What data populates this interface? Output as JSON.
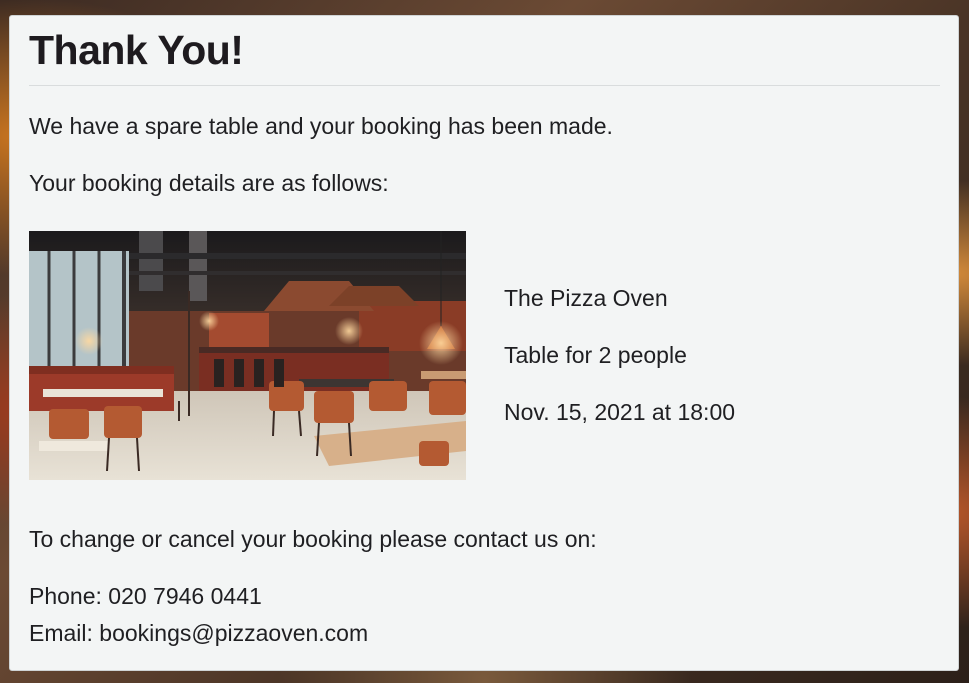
{
  "confirmation": {
    "title": "Thank You!",
    "intro": "We have a spare table and your booking has been made.",
    "details_heading": "Your booking details are as follows:",
    "image_alt": "Restaurant interior",
    "booking": {
      "restaurant": "The Pizza Oven",
      "party": "Table for 2 people",
      "datetime": "Nov. 15, 2021 at 18:00"
    },
    "contact_heading": "To change or cancel your booking please contact us on:",
    "phone": "Phone: 020 7946 0441",
    "email": "Email: bookings@pizzaoven.com"
  },
  "colors": {
    "card_background": "#f3f5f5",
    "text": "#1f1f22"
  }
}
